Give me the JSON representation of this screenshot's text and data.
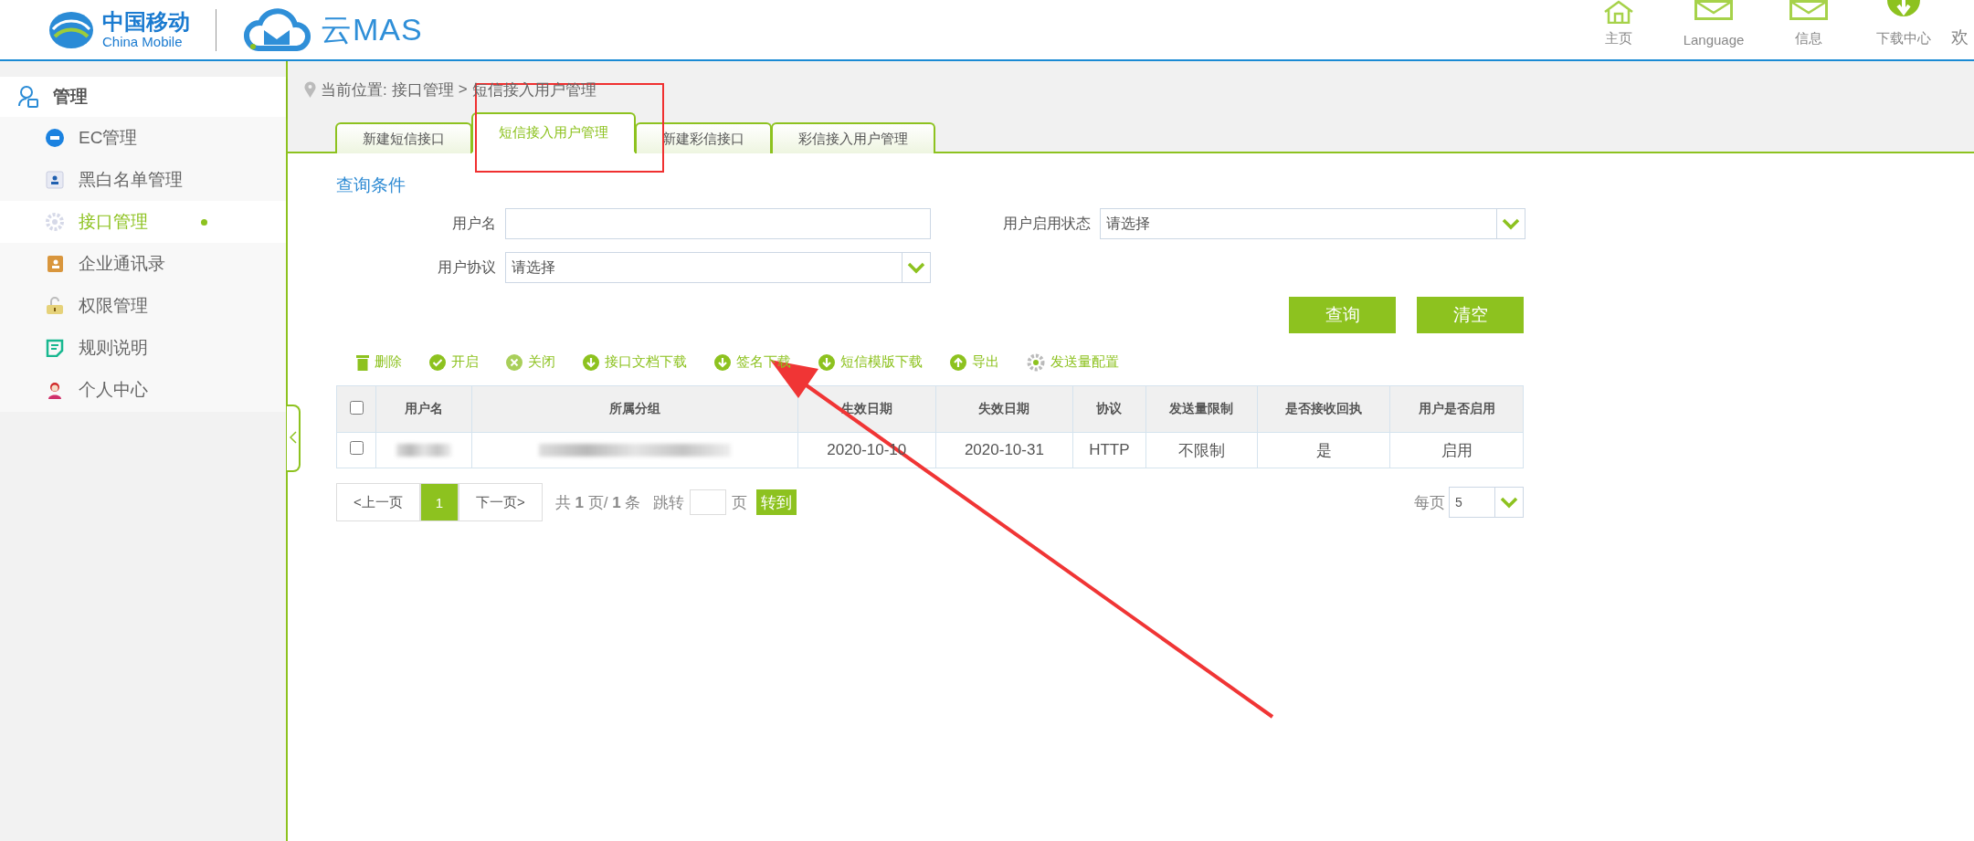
{
  "header": {
    "brand_cn": "中国移动",
    "brand_en": "China Mobile",
    "product": "云MAS",
    "nav": [
      {
        "label": "主页",
        "kind": "home"
      },
      {
        "label": "Language",
        "kind": "mail"
      },
      {
        "label": "信息",
        "kind": "mail"
      },
      {
        "label": "下载中心",
        "kind": "download"
      }
    ],
    "welcome": "欢"
  },
  "sidebar": {
    "title": "管理",
    "items": [
      {
        "label": "EC管理",
        "selected": false
      },
      {
        "label": "黑白名单管理",
        "selected": false
      },
      {
        "label": "接口管理",
        "selected": true
      },
      {
        "label": "企业通讯录",
        "selected": false
      },
      {
        "label": "权限管理",
        "selected": false
      },
      {
        "label": "规则说明",
        "selected": false
      },
      {
        "label": "个人中心",
        "selected": false
      }
    ]
  },
  "breadcrumb": {
    "prefix": "当前位置:",
    "path": [
      "接口管理",
      "短信接入用户管理"
    ],
    "separator": ">"
  },
  "tabs": [
    {
      "label": "新建短信接口",
      "selected": false
    },
    {
      "label": "短信接入用户管理",
      "selected": true
    },
    {
      "label": "新建彩信接口",
      "selected": false
    },
    {
      "label": "彩信接入用户管理",
      "selected": false
    }
  ],
  "query": {
    "title": "查询条件",
    "fields": [
      {
        "label": "用户名",
        "kind": "input"
      },
      {
        "label": "用户启用状态",
        "kind": "select",
        "value": "请选择"
      },
      {
        "label": "用户协议",
        "kind": "select",
        "value": "请选择"
      }
    ],
    "buttons": [
      "查询",
      "清空"
    ]
  },
  "toolbar": [
    {
      "label": "删除",
      "kind": "delete"
    },
    {
      "label": "开启",
      "kind": "enable"
    },
    {
      "label": "关闭",
      "kind": "disable"
    },
    {
      "label": "接口文档下载",
      "kind": "download"
    },
    {
      "label": "签名下载",
      "kind": "download"
    },
    {
      "label": "短信模版下载",
      "kind": "download"
    },
    {
      "label": "导出",
      "kind": "export"
    },
    {
      "label": "发送量配置",
      "kind": "config"
    }
  ],
  "table": {
    "all_checked": false,
    "columns": [
      "用户名",
      "所属分组",
      "生效日期",
      "失效日期",
      "协议",
      "发送量限制",
      "是否接收回执",
      "用户是否启用"
    ],
    "rows": [
      {
        "checked": false,
        "cells": [
          {
            "kind": "redacted"
          },
          {
            "kind": "redacted"
          },
          {
            "kind": "text",
            "text": "2020-10-10"
          },
          {
            "kind": "text",
            "text": "2020-10-31"
          },
          {
            "kind": "text",
            "text": "HTTP"
          },
          {
            "kind": "text",
            "text": "不限制"
          },
          {
            "kind": "text",
            "text": "是"
          },
          {
            "kind": "text",
            "text": "启用"
          }
        ]
      }
    ]
  },
  "pagination": {
    "prev": "<上一页",
    "pages": [
      {
        "label": "1",
        "selected": true
      }
    ],
    "next": "下一页>",
    "summary": "共 **1** 页/ **1** 条",
    "jump_label": "跳转",
    "jump_unit": "页",
    "go": "转到",
    "per_page_label": "每页",
    "per_page": "5"
  }
}
